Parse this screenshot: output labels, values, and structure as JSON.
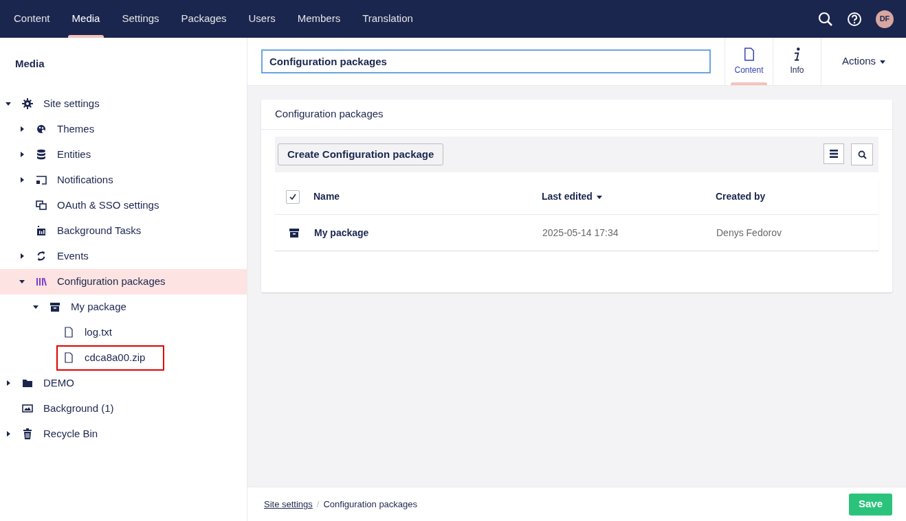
{
  "top_nav": {
    "sections": [
      {
        "label": "Content",
        "selected": false
      },
      {
        "label": "Media",
        "selected": true
      },
      {
        "label": "Settings",
        "selected": false
      },
      {
        "label": "Packages",
        "selected": false
      },
      {
        "label": "Users",
        "selected": false
      },
      {
        "label": "Members",
        "selected": false
      },
      {
        "label": "Translation",
        "selected": false
      }
    ],
    "avatar_initials": "DF"
  },
  "sidebar": {
    "title": "Media",
    "tree": [
      {
        "label": "Site settings",
        "kind": "gear",
        "expanded": true,
        "selected": false,
        "children": [
          {
            "label": "Themes",
            "kind": "palette",
            "expanded": false,
            "selected": false
          },
          {
            "label": "Entities",
            "kind": "database",
            "expanded": false,
            "selected": false
          },
          {
            "label": "Notifications",
            "kind": "screen",
            "expanded": false,
            "selected": false
          },
          {
            "label": "OAuth & SSO settings",
            "kind": "windows",
            "selected": false
          },
          {
            "label": "Background Tasks",
            "kind": "tasks",
            "selected": false
          },
          {
            "label": "Events",
            "kind": "sync",
            "expanded": false,
            "selected": false
          },
          {
            "label": "Configuration packages",
            "kind": "library",
            "expanded": true,
            "selected": true,
            "children": [
              {
                "label": "My package",
                "kind": "box",
                "expanded": true,
                "selected": false,
                "children": [
                  {
                    "label": "log.txt",
                    "kind": "file",
                    "selected": false,
                    "highlighted": false
                  },
                  {
                    "label": "cdca8a00.zip",
                    "kind": "file",
                    "selected": false,
                    "highlighted": true
                  }
                ]
              }
            ]
          }
        ]
      },
      {
        "label": "DEMO",
        "kind": "folder",
        "expanded": false,
        "selected": false
      },
      {
        "label": "Background (1)",
        "kind": "image",
        "selected": false
      },
      {
        "label": "Recycle Bin",
        "kind": "trash",
        "expanded": false,
        "selected": false
      }
    ]
  },
  "editor": {
    "name_value": "Configuration packages",
    "apps": [
      {
        "label": "Content",
        "kind": "file",
        "selected": true
      },
      {
        "label": "Info",
        "kind": "info",
        "selected": false
      }
    ],
    "actions_label": "Actions",
    "card_title": "Configuration packages",
    "create_button": "Create Configuration package",
    "table": {
      "select_all_checked": true,
      "columns": [
        {
          "label": "Name",
          "sorted": false
        },
        {
          "label": "Last edited",
          "sorted": true
        },
        {
          "label": "Created by",
          "sorted": false
        }
      ],
      "rows": [
        {
          "name": "My package",
          "last_edited": "2025-05-14 17:34",
          "created_by": "Denys Fedorov"
        }
      ]
    }
  },
  "footer": {
    "breadcrumbs": [
      "Site settings",
      "Configuration packages"
    ],
    "breadcrumb_separator": "/",
    "save_button": "Save"
  }
}
